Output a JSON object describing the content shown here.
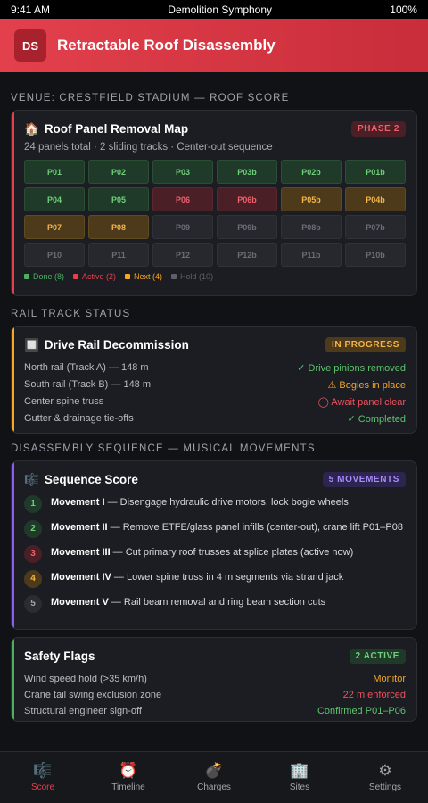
{
  "status": {
    "time": "9:41 AM",
    "app": "Demolition Symphony",
    "battery": "100%"
  },
  "header": {
    "logo": "DS",
    "title": "Retractable Roof Disassembly"
  },
  "sections": {
    "venue": "VENUE: CRESTFIELD STADIUM — ROOF SCORE",
    "rail": "RAIL TRACK STATUS",
    "sequence": "DISASSEMBLY SEQUENCE — MUSICAL MOVEMENTS"
  },
  "map": {
    "icon": "🏠",
    "title": "Roof Panel Removal Map",
    "badge": "PHASE 2",
    "subtitle": "24 panels total · 2 sliding tracks · Center-out sequence",
    "cells": [
      {
        "id": "P01",
        "s": "done"
      },
      {
        "id": "P02",
        "s": "done"
      },
      {
        "id": "P03",
        "s": "done"
      },
      {
        "id": "P03b",
        "s": "done"
      },
      {
        "id": "P02b",
        "s": "done"
      },
      {
        "id": "P01b",
        "s": "done"
      },
      {
        "id": "P04",
        "s": "done"
      },
      {
        "id": "P05",
        "s": "done"
      },
      {
        "id": "P06",
        "s": "active"
      },
      {
        "id": "P06b",
        "s": "active"
      },
      {
        "id": "P05b",
        "s": "next"
      },
      {
        "id": "P04b",
        "s": "next"
      },
      {
        "id": "P07",
        "s": "next"
      },
      {
        "id": "P08",
        "s": "next"
      },
      {
        "id": "P09",
        "s": "hold"
      },
      {
        "id": "P09b",
        "s": "hold"
      },
      {
        "id": "P08b",
        "s": "hold"
      },
      {
        "id": "P07b",
        "s": "hold"
      },
      {
        "id": "P10",
        "s": "hold"
      },
      {
        "id": "P11",
        "s": "hold"
      },
      {
        "id": "P12",
        "s": "hold"
      },
      {
        "id": "P12b",
        "s": "hold"
      },
      {
        "id": "P11b",
        "s": "hold"
      },
      {
        "id": "P10b",
        "s": "hold"
      }
    ],
    "legend": [
      {
        "label": "Done (8)",
        "color": "#4caf60"
      },
      {
        "label": "Active (2)",
        "color": "#e2404c"
      },
      {
        "label": "Next (4)",
        "color": "#f5a623"
      },
      {
        "label": "Hold (10)",
        "color": "#5d6068"
      }
    ]
  },
  "rail": {
    "icon": "🔲",
    "title": "Drive Rail Decommission",
    "badge": "IN PROGRESS",
    "rows": [
      {
        "label": "North rail (Track A) — 148 m",
        "value": "✓ Drive pinions removed",
        "color": "#5cc46c"
      },
      {
        "label": "South rail (Track B) — 148 m",
        "value": "⚠ Bogies in place",
        "color": "#f5a623"
      },
      {
        "label": "Center spine truss",
        "value": "◯ Await panel clear",
        "color": "#f2505c"
      },
      {
        "label": "Gutter & drainage tie-offs",
        "value": "✓ Completed",
        "color": "#5cc46c"
      }
    ]
  },
  "sequence": {
    "icon": "🎼",
    "title": "Sequence Score",
    "badge": "5 MOVEMENTS",
    "movements": [
      {
        "n": "1",
        "name": "Movement I",
        "text": " — Disengage hydraulic drive motors, lock bogie wheels",
        "bg": "#1f3a28",
        "fg": "#6fcf7b"
      },
      {
        "n": "2",
        "name": "Movement II",
        "text": " — Remove ETFE/glass panel infills (center-out), crane lift P01–P08",
        "bg": "#1f3a28",
        "fg": "#6fcf7b"
      },
      {
        "n": "3",
        "name": "Movement III",
        "text": " — Cut primary roof trusses at splice plates (active now)",
        "bg": "#4a1f26",
        "fg": "#f2606b"
      },
      {
        "n": "4",
        "name": "Movement IV",
        "text": " — Lower spine truss in 4 m segments via strand jack",
        "bg": "#4c3a1a",
        "fg": "#f5b54a"
      },
      {
        "n": "5",
        "name": "Movement V",
        "text": " — Rail beam removal and ring beam section cuts",
        "bg": "#2a2c31",
        "fg": "#a3a6ad"
      }
    ]
  },
  "safety": {
    "title": "Safety Flags",
    "badge": "2 ACTIVE",
    "rows": [
      {
        "label": "Wind speed hold (>35 km/h)",
        "value": "Monitor",
        "color": "#f5a623"
      },
      {
        "label": "Crane tail swing exclusion zone",
        "value": "22 m enforced",
        "color": "#f2505c"
      },
      {
        "label": "Structural engineer sign-off",
        "value": "Confirmed P01–P06",
        "color": "#5cc46c"
      }
    ]
  },
  "tabs": [
    {
      "icon": "🎼",
      "label": "Score",
      "name": "score",
      "active": true
    },
    {
      "icon": "⏰",
      "label": "Timeline",
      "name": "timeline",
      "active": false
    },
    {
      "icon": "💣",
      "label": "Charges",
      "name": "charges",
      "active": false
    },
    {
      "icon": "🏢",
      "label": "Sites",
      "name": "sites",
      "active": false
    },
    {
      "icon": "⚙",
      "label": "Settings",
      "name": "settings",
      "active": false
    }
  ]
}
